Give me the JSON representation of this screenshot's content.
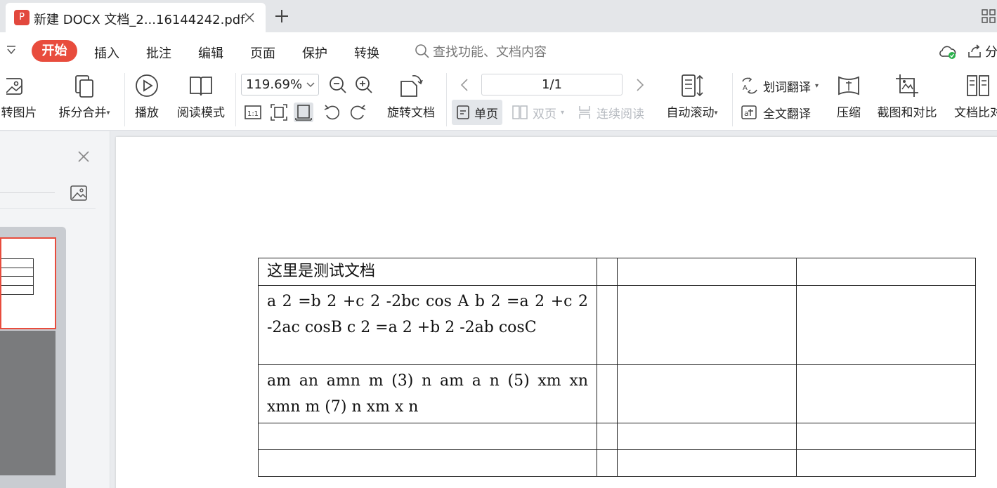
{
  "tab": {
    "icon_glyph": "P",
    "title": "新建 DOCX 文档_2...16144242.pdf"
  },
  "menu": {
    "items": [
      {
        "label": "开始",
        "active": true
      },
      {
        "label": "插入"
      },
      {
        "label": "批注"
      },
      {
        "label": "编辑"
      },
      {
        "label": "页面"
      },
      {
        "label": "保护"
      },
      {
        "label": "转换"
      }
    ],
    "search_placeholder": "查找功能、文档内容",
    "share_label": "分"
  },
  "toolbar": {
    "to_image": "转图片",
    "split_merge": "拆分合并",
    "play": "播放",
    "read_mode": "阅读模式",
    "zoom_value": "119.69%",
    "rotate_doc": "旋转文档",
    "page_indicator": "1/1",
    "single_page": "单页",
    "double_page": "双页",
    "continuous": "连续阅读",
    "auto_scroll": "自动滚动",
    "word_translate": "划词翻译",
    "full_translate": "全文翻译",
    "compress": "压缩",
    "screenshot_compare": "截图和对比",
    "doc_compare": "文档比对"
  },
  "document": {
    "rows": [
      [
        "这里是测试文档",
        "",
        "",
        ""
      ],
      [
        "a 2 =b 2 +c 2 -2bc cos A b 2 =a 2 +c 2 -2ac cosB c 2 =a 2 +b 2 -2ab cosC",
        "",
        "",
        ""
      ],
      [
        "am an amn m (3) n am a n (5) xm xn xmn m (7) n xm x n",
        "",
        "",
        ""
      ],
      [
        "",
        "",
        "",
        ""
      ],
      [
        "",
        "",
        "",
        ""
      ]
    ]
  },
  "colors": {
    "accent": "#e84c3d",
    "toolbar_bg": "#ffffff",
    "canvas_bg": "#e9ebee"
  }
}
